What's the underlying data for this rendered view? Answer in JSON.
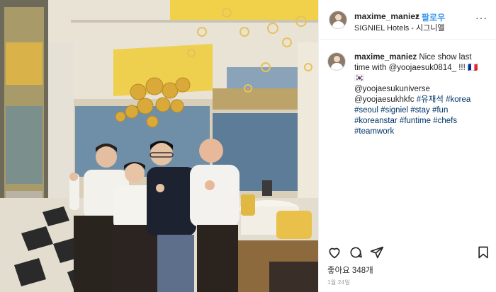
{
  "header": {
    "username": "maxime_maniez",
    "separator": "•",
    "follow_label": "팔로우",
    "location": "SIGNIEL Hotels - 시그니엘",
    "more_label": "···"
  },
  "caption": {
    "username": "maxime_maniez",
    "text": "Nice show last time with",
    "mention1": "@yoojaesuk0814_",
    "tail": "!!! 🇫🇷🇰🇷",
    "line2": "@yoojaesukuniverse @yoojaesukhkfc",
    "hashtags": "#유재석 #korea #seoul #signiel #stay #fun #koreanstar #funtime #chefs #teamwork"
  },
  "actions": {
    "icons": [
      "heart-icon",
      "comment-icon",
      "share-icon",
      "bookmark-icon"
    ]
  },
  "likes_label": "좋아요 348개",
  "date_label": "1월 24일",
  "colors": {
    "link": "#3897f0",
    "text": "#262626",
    "hashtag": "#003569",
    "gold": "#e8c04a"
  }
}
